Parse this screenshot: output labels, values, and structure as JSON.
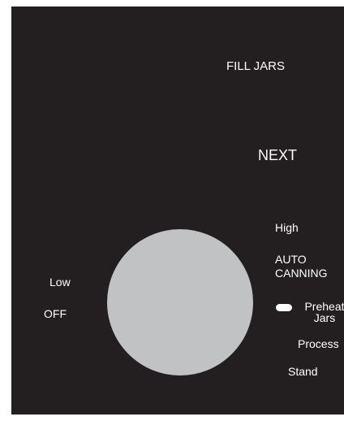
{
  "labels": {
    "fill_jars": "FILL JARS",
    "next": "NEXT",
    "high": "High",
    "auto_canning": "AUTO CANNING",
    "low": "Low",
    "off": "OFF",
    "preheat_jars": "Preheat Jars",
    "process": "Process",
    "stand": "Stand"
  },
  "colors": {
    "panel_background": "#231f20",
    "knob": "#c0c2c4",
    "text": "#ffffff"
  },
  "knob": {
    "selected_setting": "Preheat Jars"
  }
}
